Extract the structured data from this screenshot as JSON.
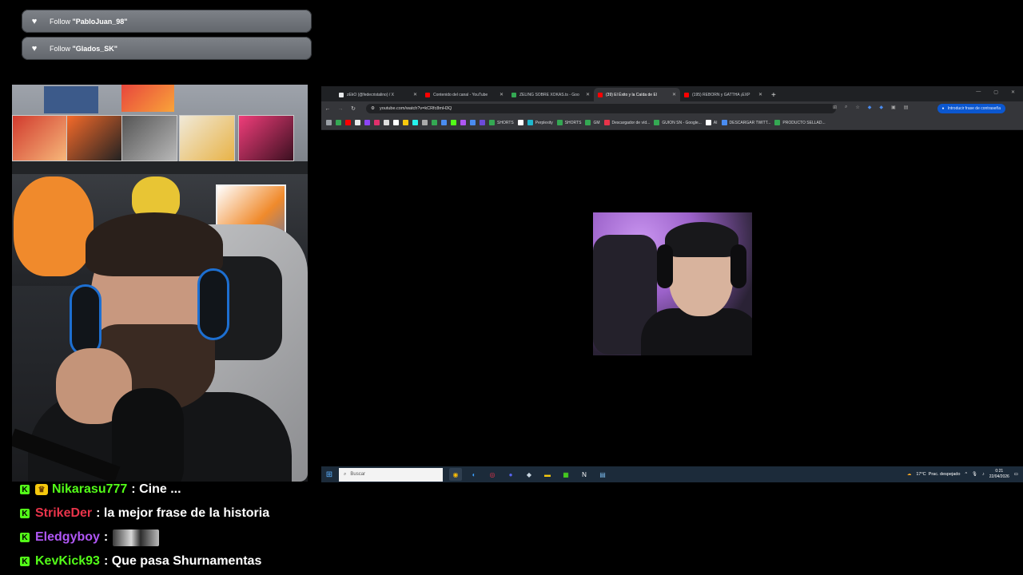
{
  "alerts": [
    {
      "prefix": "Follow ",
      "user": "\"PabloJuan_98\""
    },
    {
      "prefix": "Follow ",
      "user": "\"Glados_SK\""
    }
  ],
  "chat": [
    {
      "user": "Nikarasu777",
      "color": "#53fc18",
      "badge": "crown",
      "message": ": Cine ..."
    },
    {
      "user": "StrikeDer",
      "color": "#e8344a",
      "message": ": la mejor frase de la historia"
    },
    {
      "user": "Eledgyboy",
      "color": "#b057f5",
      "message": ":",
      "emote": true
    },
    {
      "user": "KevKick93",
      "color": "#53fc18",
      "message": ": Que pasa Shurnamentas"
    }
  ],
  "browser": {
    "tabs": [
      {
        "title": "zEkO (@fedecristalino) / X",
        "color": "#e7e9ea"
      },
      {
        "title": "Contenido del canal - YouTube",
        "color": "#ff0000"
      },
      {
        "title": "ZELING SOBRE XOKAS.ts - Goo",
        "color": "#34a853"
      },
      {
        "title": "(39) El Éxito y la Caída de El",
        "color": "#ff0000",
        "active": true
      },
      {
        "title": "(195) REBORN y GATTHA ¡EXP",
        "color": "#ff0000"
      }
    ],
    "new_tab": "+",
    "url": "youtube.com/watch?v=kCRfc8mH3Q",
    "password_prompt": "Introducir frase de contraseña",
    "bookmarks": [
      "SHORTS",
      "Perplexity",
      "SHORTS",
      "GM",
      "Descargador de víd...",
      "GUION SN - Google...",
      "AI",
      "DESCARGAR TWITT...",
      "PRODUCTO SELLAD..."
    ]
  },
  "taskbar": {
    "search_placeholder": "Buscar",
    "weather": "17°C  Prac. despejado",
    "time": "0:21",
    "date": "22/04/2026"
  },
  "colors": {
    "kick_green": "#53fc18",
    "taskbar": "#1c2b3a",
    "chrome_dark": "#35363a"
  }
}
